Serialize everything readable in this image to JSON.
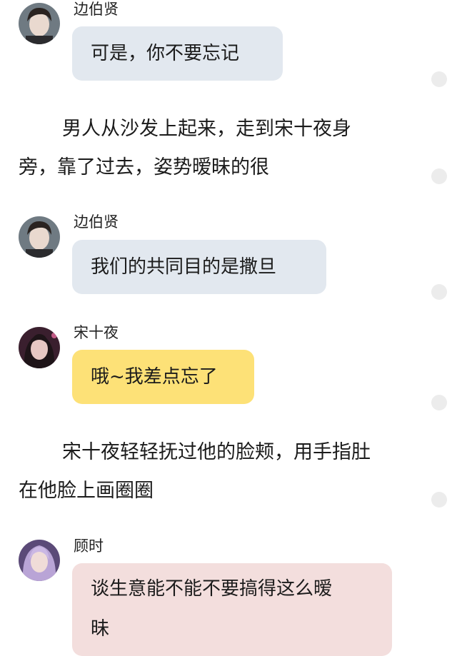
{
  "messages": [
    {
      "speaker": "边伯贤",
      "text": "可是，你不要忘记",
      "avatar": "male-portrait-avatar",
      "bubble_color": "#e2e8ef"
    },
    {
      "speaker": "边伯贤",
      "text": "我们的共同目的是撒旦",
      "avatar": "male-portrait-avatar",
      "bubble_color": "#e2e8ef"
    },
    {
      "speaker": "宋十夜",
      "text": "哦~我差点忘了",
      "avatar": "female-portrait-avatar",
      "bubble_color": "#fde177"
    },
    {
      "speaker": "顾时",
      "text_line1": "谈生意能不能不要搞得这么暧",
      "text_line2": "昧",
      "avatar": "purple-hair-portrait-avatar",
      "bubble_color": "#f3dedd"
    }
  ],
  "narration": [
    {
      "line1": "男人从沙发上起来，走到宋十夜身",
      "line2": "旁，靠了过去，姿势暧昧的很"
    },
    {
      "line1": "宋十夜轻轻抚过他的脸颊，用手指肚",
      "line2": "在他脸上画圈圈"
    }
  ],
  "side_indicator_color": "#ececec"
}
